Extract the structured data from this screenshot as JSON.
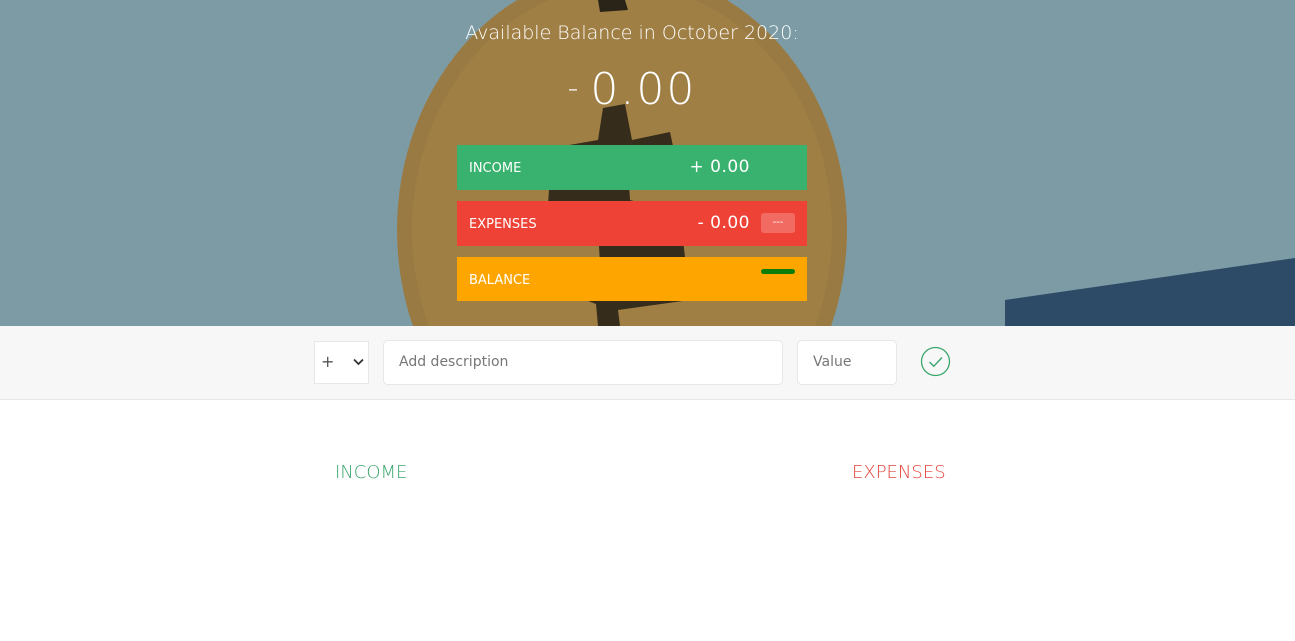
{
  "budget": {
    "title": "Available Balance in October 2020:",
    "sign": "-",
    "value": "0.00"
  },
  "summary": {
    "income": {
      "label": "INCOME",
      "value": "+ 0.00"
    },
    "expenses": {
      "label": "EXPENSES",
      "value": "- 0.00",
      "percentage": "---"
    },
    "balance": {
      "label": "BALANCE"
    }
  },
  "add_form": {
    "type_value": "+",
    "description_placeholder": "Add description",
    "value_placeholder": "Value"
  },
  "lists": {
    "income_title": "INCOME",
    "expenses_title": "EXPENSES"
  },
  "colors": {
    "income": "#3ab26f",
    "expenses": "#ef4237",
    "balance": "#ffa500",
    "balance_indicator": "#0a7d0a"
  },
  "icons": {
    "add_button": "checkmark-circle-icon",
    "type_select": "chevron-down-icon"
  }
}
